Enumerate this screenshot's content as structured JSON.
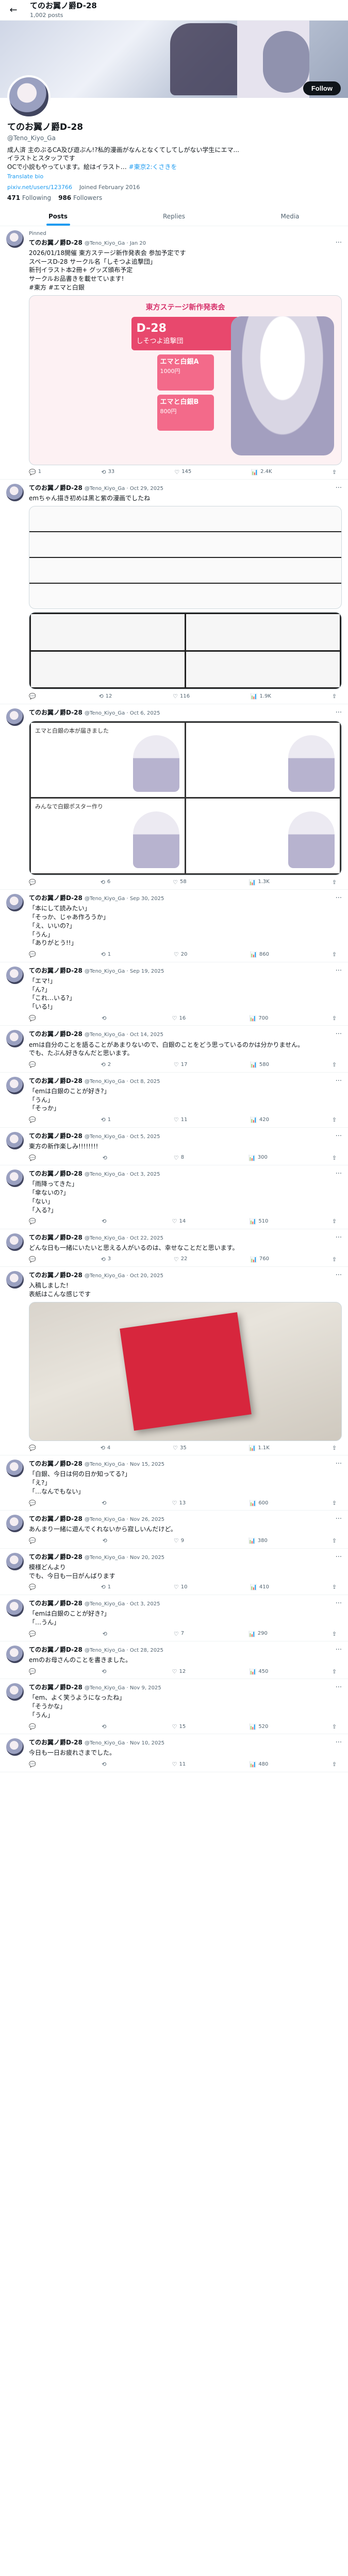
{
  "topbar": {
    "back_glyph": "←",
    "name": "てのお翼ノ爵D-28",
    "post_count": "1,002 posts"
  },
  "profile": {
    "name": "てのお翼ノ爵D-28",
    "handle": "@Teno_Kiyo_Ga",
    "follow_label": "Follow",
    "bio": "成人済 主のぶるCA及び遊ぶん!?私的漫画がなんとなくてしてしがない学生にエマ...\nイラストとスタッフです\nOCで小説もやっています。絵はイラスト…",
    "bio_link": "#東京2:くさきを",
    "translate": "Translate bio",
    "location": "pixiv.net/users/123766",
    "joined": "Joined February 2016",
    "following_count": "471",
    "following_label": "Following",
    "followers_count": "986",
    "followers_label": "Followers"
  },
  "tabs": [
    {
      "label": "Posts",
      "active": true
    },
    {
      "label": "Replies",
      "active": false
    },
    {
      "label": "Media",
      "active": false
    }
  ],
  "tweets": [
    {
      "label": "Pinned",
      "name": "てのお翼ノ爵D-28",
      "handle": "@Teno_Kiyo_Ga · Jan 20",
      "text": "2026/01/18開催 東方ステージ新作発表会 参加予定です\nスペースD-28 サークル名「しそつよ追撃団」\n新刊イラスト本2冊+ グッズ頒布予定\nサークルお品書きを載せています!\n#東方 #エマと白銀",
      "media": "flyer",
      "flyer": {
        "head": "東方ステージ新作発表会",
        "space": "D-28",
        "circle": "しそつよ追撃団",
        "item1": "エマと白銀A",
        "price1": "1000円",
        "item2": "エマと白銀B",
        "price2": "800円"
      },
      "stats": [
        "1",
        "33",
        "145",
        "2.4K"
      ]
    },
    {
      "label": "",
      "name": "てのお翼ノ爵D-28",
      "handle": "@Teno_Kiyo_Ga · Oct 29, 2025",
      "text": "emちゃん描き初めは黒と紫の漫画でしたね",
      "media": "manga",
      "stats": [
        "",
        "12",
        "116",
        "1.9K"
      ]
    },
    {
      "label": "",
      "name": "てのお翼ノ爵D-28",
      "handle": "@Teno_Kiyo_Ga · Oct 6, 2025",
      "text": "",
      "media": "comic",
      "comic": {
        "top": "エマと白銀の本が届きました",
        "bottom": "みんなで白銀ポスター作り"
      },
      "stats": [
        "",
        "6",
        "58",
        "1.3K"
      ]
    },
    {
      "label": "",
      "name": "てのお翼ノ爵D-28",
      "handle": "@Teno_Kiyo_Ga · Sep 30, 2025",
      "text": "「本にして読みたい」\n「そっか、じゃあ作ろうか」\n「え、いいの?」\n「うん」\n「ありがとう!!」",
      "media": "",
      "stats": [
        "",
        "1",
        "20",
        "860"
      ]
    },
    {
      "label": "",
      "name": "てのお翼ノ爵D-28",
      "handle": "@Teno_Kiyo_Ga · Sep 19, 2025",
      "text": "「エマ!」\n「ん?」\n「これ…いる?」\n「いる!」",
      "media": "",
      "stats": [
        "",
        "",
        "16",
        "700"
      ]
    },
    {
      "label": "",
      "name": "てのお翼ノ爵D-28",
      "handle": "@Teno_Kiyo_Ga · Oct 14, 2025",
      "text": "emは自分のことを語ることがあまりないので、白銀のことをどう思っているのかは分かりません。\nでも、たぶん好きなんだと思います。",
      "media": "",
      "stats": [
        "",
        "2",
        "17",
        "580"
      ]
    },
    {
      "label": "",
      "name": "てのお翼ノ爵D-28",
      "handle": "@Teno_Kiyo_Ga · Oct 8, 2025",
      "text": "「emは白銀のことが好き?」\n「うん」\n「そっか」",
      "media": "",
      "stats": [
        "",
        "1",
        "11",
        "420"
      ]
    },
    {
      "label": "",
      "name": "てのお翼ノ爵D-28",
      "handle": "@Teno_Kiyo_Ga · Oct 5, 2025",
      "text": "東方の新作楽しみ!!!!!!!!",
      "media": "",
      "stats": [
        "",
        "",
        "8",
        "300"
      ]
    },
    {
      "label": "",
      "name": "てのお翼ノ爵D-28",
      "handle": "@Teno_Kiyo_Ga · Oct 3, 2025",
      "text": "「雨降ってきた」\n「傘ないの?」\n「ない」\n「入る?」",
      "media": "",
      "stats": [
        "",
        "",
        "14",
        "510"
      ]
    },
    {
      "label": "",
      "name": "てのお翼ノ爵D-28",
      "handle": "@Teno_Kiyo_Ga · Oct 22, 2025",
      "text": "どんな日も一緒にいたいと思える人がいるのは、幸せなことだと思います。",
      "media": "",
      "stats": [
        "",
        "3",
        "22",
        "760"
      ]
    },
    {
      "label": "",
      "name": "てのお翼ノ爵D-28",
      "handle": "@Teno_Kiyo_Ga · Oct 20, 2025",
      "text": "入稿しました!\n表紙はこんな感じです",
      "media": "book",
      "stats": [
        "",
        "4",
        "35",
        "1.1K"
      ]
    },
    {
      "label": "",
      "name": "てのお翼ノ爵D-28",
      "handle": "@Teno_Kiyo_Ga · Nov 15, 2025",
      "text": "「白銀、今日は何の日か知ってる?」\n「え?」\n「…なんでもない」",
      "media": "",
      "stats": [
        "",
        "",
        "13",
        "600"
      ]
    },
    {
      "label": "",
      "name": "てのお翼ノ爵D-28",
      "handle": "@Teno_Kiyo_Ga · Nov 26, 2025",
      "text": "あんまり一緒に遊んでくれないから寂しいんだけど。",
      "media": "",
      "stats": [
        "",
        "",
        "9",
        "380"
      ]
    },
    {
      "label": "",
      "name": "てのお翼ノ爵D-28",
      "handle": "@Teno_Kiyo_Ga · Nov 20, 2025",
      "text": "模様どんより\nでも、今日も一日がんばります",
      "media": "",
      "stats": [
        "",
        "1",
        "10",
        "410"
      ]
    },
    {
      "label": "",
      "name": "てのお翼ノ爵D-28",
      "handle": "@Teno_Kiyo_Ga · Oct 3, 2025",
      "text": "「emは白銀のことが好き?」\n「…うん」",
      "media": "",
      "stats": [
        "",
        "",
        "7",
        "290"
      ]
    },
    {
      "label": "",
      "name": "てのお翼ノ爵D-28",
      "handle": "@Teno_Kiyo_Ga · Oct 28, 2025",
      "text": "emのお母さんのことを書きました。",
      "media": "",
      "stats": [
        "",
        "",
        "12",
        "450"
      ]
    },
    {
      "label": "",
      "name": "てのお翼ノ爵D-28",
      "handle": "@Teno_Kiyo_Ga · Nov 9, 2025",
      "text": "「em、よく笑うようになったね」\n「そうかな」\n「うん」",
      "media": "",
      "stats": [
        "",
        "",
        "15",
        "520"
      ]
    },
    {
      "label": "",
      "name": "てのお翼ノ爵D-28",
      "handle": "@Teno_Kiyo_Ga · Nov 10, 2025",
      "text": "今日も一日お疲れさまでした。",
      "media": "",
      "stats": [
        "",
        "",
        "11",
        "480"
      ]
    }
  ],
  "icons": {
    "reply": "💬",
    "repost": "⟲",
    "like": "♡",
    "views": "📊",
    "share": "⇪",
    "more": "···"
  }
}
